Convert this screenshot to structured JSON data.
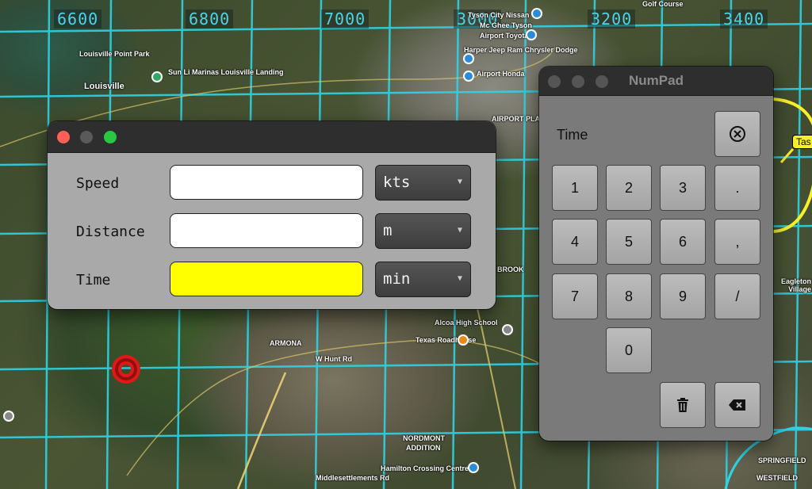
{
  "map": {
    "grid_numbers": [
      "6600",
      "6800",
      "7000",
      "3000",
      "3200",
      "3400"
    ],
    "labels": [
      "Louisville Point Park",
      "Sun Li Marinas Louisville Landing",
      "Louisville",
      "Harper Jeep Ram Chrysler Dodge",
      "Airport Honda",
      "Airport Toyota",
      "Tyson City Nissan",
      "Mc Ghee Tyson",
      "AIRPORT PLAZA",
      "ARMONA",
      "Alcoa High School",
      "Texas Roadhouse",
      "Hamilton Crossing Centre",
      "ADDITION",
      "NORDMONT",
      "SPRINGFIELD",
      "WESTFIELD",
      "Eagleton Village",
      "Golf Course",
      "BROOK",
      "W Hunt Rd",
      "Middlesettlements Rd"
    ],
    "waypoint_tag": "Tas"
  },
  "calculator": {
    "rows": [
      {
        "label": "Speed",
        "value": "",
        "unit": "kts"
      },
      {
        "label": "Distance",
        "value": "",
        "unit": "m"
      },
      {
        "label": "Time",
        "value": "",
        "unit": "min"
      }
    ]
  },
  "numpad": {
    "title": "NumPad",
    "active_field": "Time",
    "keys": [
      "1",
      "2",
      "3",
      ".",
      "4",
      "5",
      "6",
      ",",
      "7",
      "8",
      "9",
      "/",
      "0"
    ],
    "clear_icon": "circle-x-icon",
    "trash_icon": "trash-icon",
    "backspace_icon": "backspace-icon"
  },
  "colors": {
    "grid_line": "#2fd3e6",
    "time_field_highlight": "#ffff00",
    "close_light": "#ff5f57",
    "minimize_light": "#5a5a5a",
    "zoom_light": "#28c840",
    "target": "#e01818",
    "tag": "#f7ef2a"
  }
}
